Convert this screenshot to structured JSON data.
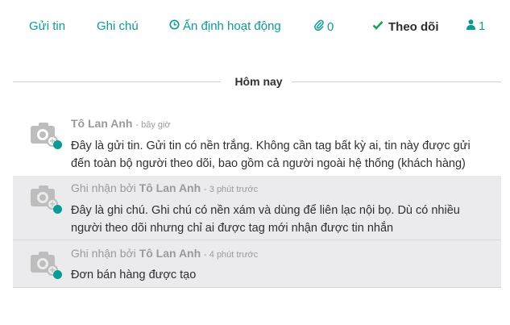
{
  "topbar": {
    "send_message": "Gửi tin",
    "log_note": "Ghi chú",
    "schedule_activity": "Ấn định hoạt động",
    "attachments_count": "0",
    "follow_label": "Theo dõi",
    "followers_count": "1"
  },
  "icons": {
    "schedule": "clock-icon",
    "attachment": "paperclip-icon",
    "follow": "check-icon",
    "followers": "user-icon",
    "avatar": "camera-placeholder-icon"
  },
  "colors": {
    "accent": "#0a9c94",
    "follow_check": "#1aa260",
    "note_bg": "#ebebed"
  },
  "separator": {
    "label": "Hôm nay"
  },
  "messages": [
    {
      "type": "message",
      "prefix": "",
      "author": "Tô Lan Anh",
      "time": "- bây giờ",
      "body": "Đây là gửi tin. Gửi tin có nền trắng. Không cần tag bất kỳ ai, tin này được gửi đến toàn bộ người theo dõi, bao gồm cả người ngoài hệ thống (khách hàng)"
    },
    {
      "type": "note",
      "prefix": "Ghi nhận bởi",
      "author": "Tô Lan Anh",
      "time": "- 3 phút trước",
      "body": "Đây là ghi chú. Ghi chú có nền xám và dùng để liên lạc nội bọ. Dù có nhiều người theo dõi nhưng chỉ ai được tag mới nhận được tin nhắn"
    },
    {
      "type": "note",
      "prefix": "Ghi nhận bởi",
      "author": "Tô Lan Anh",
      "time": "- 4 phút trước",
      "body": "Đơn bán hàng được tạo"
    }
  ]
}
